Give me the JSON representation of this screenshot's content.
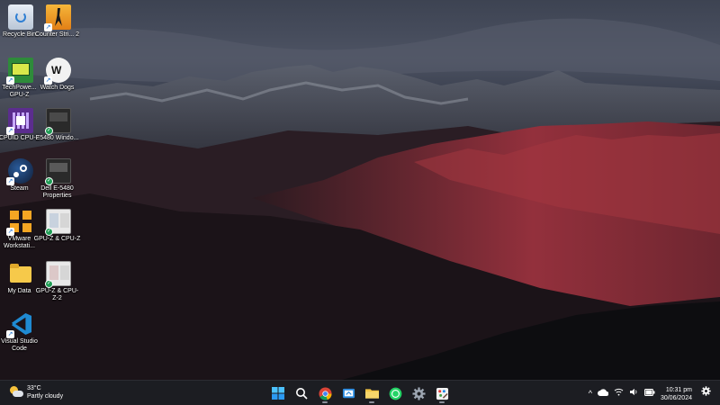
{
  "desktop": {
    "icons": [
      {
        "label": "Recycle Bin",
        "icon": "recycle-bin-icon"
      },
      {
        "label": "Counter Stri... 2",
        "icon": "counter-strike-icon"
      },
      {
        "label": "TechPowe... GPU-Z",
        "icon": "gpu-z-icon"
      },
      {
        "label": "Watch Dogs",
        "icon": "watch-dogs-icon"
      },
      {
        "label": "CPUID CPU-Z",
        "icon": "cpu-z-icon"
      },
      {
        "label": "E5480 Windo...",
        "icon": "screenshot-icon"
      },
      {
        "label": "Steam",
        "icon": "steam-icon"
      },
      {
        "label": "Dell E-5480 Properties",
        "icon": "screenshot-icon"
      },
      {
        "label": "VMware Workstati...",
        "icon": "vmware-icon"
      },
      {
        "label": "GPU-Z & CPU-Z",
        "icon": "screenshot-icon"
      },
      {
        "label": "My Data",
        "icon": "folder-icon"
      },
      {
        "label": "GPU-Z & CPU-Z-2",
        "icon": "screenshot-icon"
      },
      {
        "label": "Visual Studio Code",
        "icon": "vscode-icon"
      }
    ]
  },
  "taskbar": {
    "weather": {
      "temp": "33°C",
      "condition": "Partly cloudy",
      "icon": "partly-cloudy-icon"
    },
    "apps": [
      {
        "name": "start-button",
        "icon": "windows-logo-icon"
      },
      {
        "name": "search-button",
        "icon": "search-icon"
      },
      {
        "name": "chrome-button",
        "icon": "chrome-icon"
      },
      {
        "name": "snipping-button",
        "icon": "snipping-tool-icon"
      },
      {
        "name": "file-explorer-button",
        "icon": "folder-icon"
      },
      {
        "name": "whatsapp-button",
        "icon": "whatsapp-icon"
      },
      {
        "name": "settings-button",
        "icon": "gear-icon"
      },
      {
        "name": "paint-button",
        "icon": "paint-icon"
      }
    ],
    "tray": {
      "chevron": "^",
      "clock_time": "10:31 pm",
      "clock_date": "30/06/2024"
    }
  },
  "colors": {
    "taskbar_bg": "#1c1d22",
    "accent_blue": "#0a78d7"
  }
}
